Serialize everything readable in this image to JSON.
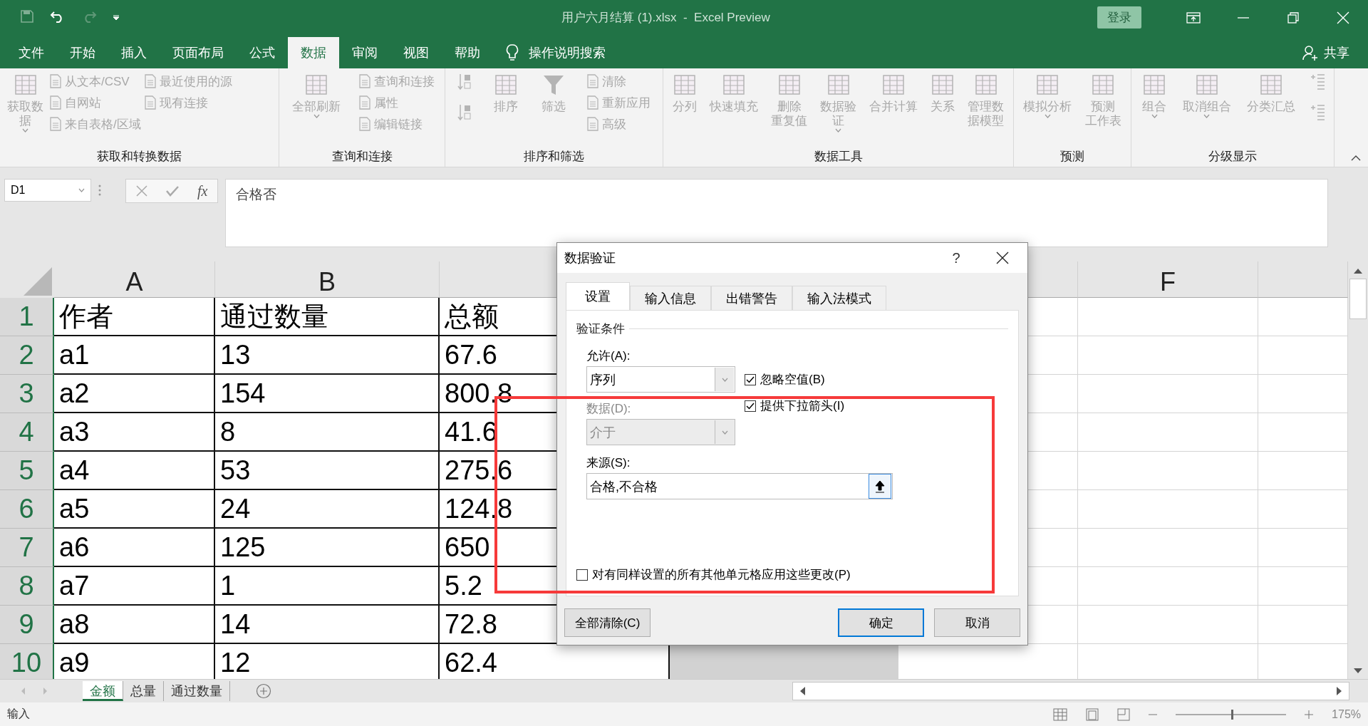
{
  "title_bar": {
    "title": "用户六月结算 (1).xlsx  -  Excel Preview",
    "sign_in": "登录"
  },
  "menu_tabs": [
    {
      "label": "文件",
      "selected": false
    },
    {
      "label": "开始",
      "selected": false
    },
    {
      "label": "插入",
      "selected": false
    },
    {
      "label": "页面布局",
      "selected": false
    },
    {
      "label": "公式",
      "selected": false
    },
    {
      "label": "数据",
      "selected": true
    },
    {
      "label": "审阅",
      "selected": false
    },
    {
      "label": "视图",
      "selected": false
    },
    {
      "label": "帮助",
      "selected": false
    }
  ],
  "tell_me": "操作说明搜索",
  "share": "共享",
  "ribbon_groups": [
    {
      "label": "获取和转换数据",
      "items": [
        {
          "kind": "large",
          "lines": [
            "获取数",
            "据"
          ],
          "caret": true
        },
        {
          "kind": "stack",
          "entries": [
            "从文本/CSV",
            "自网站",
            "来自表格/区域"
          ]
        },
        {
          "kind": "stack",
          "entries": [
            "最近使用的源",
            "现有连接"
          ]
        }
      ]
    },
    {
      "label": "查询和连接",
      "items": [
        {
          "kind": "large",
          "lines": [
            "全部刷新"
          ],
          "caret": true
        },
        {
          "kind": "stack",
          "entries": [
            "查询和连接",
            "属性",
            "编辑链接"
          ]
        }
      ]
    },
    {
      "label": "排序和筛选",
      "items": [
        {
          "kind": "sort-buttons"
        },
        {
          "kind": "large",
          "lines": [
            "排序"
          ],
          "caret": false
        },
        {
          "kind": "large",
          "lines": [
            "筛选"
          ],
          "caret": false
        },
        {
          "kind": "stack",
          "entries": [
            "清除",
            "重新应用",
            "高级"
          ]
        }
      ]
    },
    {
      "label": "数据工具",
      "items": [
        {
          "kind": "large",
          "lines": [
            "分列"
          ],
          "caret": false
        },
        {
          "kind": "large",
          "lines": [
            "快速填充"
          ],
          "caret": false
        },
        {
          "kind": "large",
          "lines": [
            "删除",
            "重复值"
          ],
          "caret": false
        },
        {
          "kind": "large",
          "lines": [
            "数据验",
            "证"
          ],
          "caret": true
        },
        {
          "kind": "large",
          "lines": [
            "合并计算"
          ],
          "caret": false
        },
        {
          "kind": "large",
          "lines": [
            "关系"
          ],
          "caret": false
        },
        {
          "kind": "large",
          "lines": [
            "管理数",
            "据模型"
          ],
          "caret": false
        }
      ]
    },
    {
      "label": "预测",
      "items": [
        {
          "kind": "large",
          "lines": [
            "模拟分析"
          ],
          "caret": true
        },
        {
          "kind": "large",
          "lines": [
            "预测",
            "工作表"
          ],
          "caret": false
        }
      ]
    },
    {
      "label": "分级显示",
      "items": [
        {
          "kind": "large",
          "lines": [
            "组合"
          ],
          "caret": true
        },
        {
          "kind": "large",
          "lines": [
            "取消组合"
          ],
          "caret": true
        },
        {
          "kind": "large",
          "lines": [
            "分类汇总"
          ],
          "caret": false
        },
        {
          "kind": "detail-buttons"
        }
      ]
    }
  ],
  "formula_bar": {
    "name_box": "D1",
    "function_label": "fx",
    "content": "合格否"
  },
  "columns": [
    {
      "label": "A",
      "selected": false
    },
    {
      "label": "B",
      "selected": false
    },
    {
      "selected": false
    },
    {
      "selected": true
    },
    {
      "selected": false
    },
    {
      "label": "F",
      "selected": false
    }
  ],
  "rows": [
    {
      "number": "1",
      "cells": [
        "作者",
        "通过数量",
        "总额"
      ]
    },
    {
      "number": "2",
      "cells": [
        "a1",
        "13",
        "67.6"
      ]
    },
    {
      "number": "3",
      "cells": [
        "a2",
        "154",
        "800.8"
      ]
    },
    {
      "number": "4",
      "cells": [
        "a3",
        "8",
        "41.6"
      ]
    },
    {
      "number": "5",
      "cells": [
        "a4",
        "53",
        "275.6"
      ]
    },
    {
      "number": "6",
      "cells": [
        "a5",
        "24",
        "124.8"
      ]
    },
    {
      "number": "7",
      "cells": [
        "a6",
        "125",
        "650"
      ]
    },
    {
      "number": "8",
      "cells": [
        "a7",
        "1",
        "5.2"
      ]
    },
    {
      "number": "9",
      "cells": [
        "a8",
        "14",
        "72.8"
      ]
    },
    {
      "number": "10",
      "cells": [
        "a9",
        "12",
        "62.4"
      ]
    }
  ],
  "sheet_tabs": [
    {
      "label": "金额",
      "selected": true
    },
    {
      "label": "总量",
      "selected": false
    },
    {
      "label": "通过数量",
      "selected": false
    }
  ],
  "status_bar": {
    "mode": "输入",
    "zoom": {
      "level": 0.5,
      "reading": "175%"
    }
  },
  "dialog": {
    "title": "数据验证",
    "help": "?",
    "tabs": [
      {
        "label": "设置",
        "selected": true
      },
      {
        "label": "输入信息",
        "selected": false
      },
      {
        "label": "出错警告",
        "selected": false
      },
      {
        "label": "输入法模式",
        "selected": false
      }
    ],
    "section": "验证条件",
    "allow_label": "允许(A):",
    "allow_value": "序列",
    "ignore_blank": {
      "label": "忽略空值(B)",
      "checked": true
    },
    "in_cell_dropdown": {
      "label": "提供下拉箭头(I)",
      "checked": true
    },
    "data_label": "数据(D):",
    "data_value": "介于",
    "data_disabled": true,
    "source_label": "来源(S):",
    "source_value": "合格,不合格",
    "apply_all": {
      "label": "对有同样设置的所有其他单元格应用这些更改(P)",
      "checked": false
    },
    "buttons": [
      {
        "label": "全部清除(C)",
        "default": false
      },
      {
        "label": "确定",
        "default": true
      },
      {
        "label": "取消",
        "default": false
      }
    ]
  },
  "annotation": {
    "kind": "frame"
  }
}
